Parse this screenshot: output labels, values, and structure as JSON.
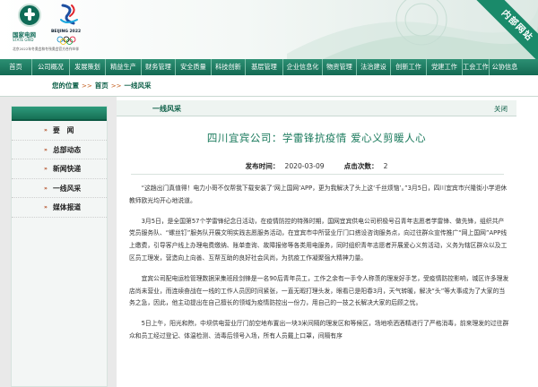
{
  "header": {
    "logo_cn": "国家电网",
    "logo_en": "STATE GRID",
    "olympic_text": "BEIJING 2022",
    "sponsor_text": "北京2022年冬奥会和冬残奥会官方合作伙伴",
    "corner_label": "内部网站",
    "colors": {
      "brand_green": "#0f6b57",
      "nav_green": "#1f7d62"
    }
  },
  "nav": {
    "items": [
      "首页",
      "公司概况",
      "发展策划",
      "精益生产",
      "财务管理",
      "安全质量",
      "科技创新",
      "基层管理",
      "企业信息化",
      "物资管理",
      "法治建设",
      "创新工作",
      "党建工作",
      "工会工作",
      "公协信息"
    ]
  },
  "breadcrumb": {
    "current_label": "您的位置",
    "items": [
      "首页",
      "一线风采"
    ]
  },
  "sidebar": {
    "items": [
      {
        "label": "要　闻",
        "icon": "double-arrow-icon"
      },
      {
        "label": "总部动态",
        "icon": "double-arrow-icon"
      },
      {
        "label": "新闻快递",
        "icon": "double-arrow-icon"
      },
      {
        "label": "一线风采",
        "icon": "double-arrow-icon"
      },
      {
        "label": "媒体报道",
        "icon": "double-arrow-icon"
      }
    ]
  },
  "content": {
    "section_title": "一线风采",
    "close_label": "关闭",
    "article_title": "四川宜宾公司：学雷锋抗疫情 爱心义剪暖人心",
    "meta": {
      "date_label": "发布时间：",
      "date_value": "2020-03-09",
      "clicks_label": "点击次数：",
      "clicks_value": "2"
    },
    "paragraphs": [
      "“这趟出门真值得！电力小哥不仅帮我下载安装了‘网上国网’APP，更为我解决了头上这‘千丝烦恼’。”3月5日，四川宜宾市兴隆街小学退休教师欧光均开心地说道。",
      "3月5日，是全国第57个学雷锋纪念日活动，在疫情防控的特殊时期，国网宜宾供电公司积极号召青年志愿者学雷锋、做先锋，组织共产党员服务队、“螺丝钉”服务队开展文明实践志愿服务活动，在宜宾市中所营业厅门口搭设咨询服务点，向过往群众宣传推广“网上国网”APP线上缴费，引导客户线上办理电费缴纳、账单查询、故障报修等各类用电服务，同时组织青年志愿者开展爱心义剪活动，义务为辖区群众以及工区员工理发，营造向上向善、互帮互助的良好社会风尚，为抗疫工作凝聚强大精神力量。",
      "宜宾公司配电运检管理数据采集班段剑锋是一名90后青年员工，工作之余有一手令人称羡的理发好手艺，受疫情防控影响，城区许多理发店尚未营业，而连续奋战在一线的工作人员因时间紧张，一直无暇打理头发，眼看已是阳春3月，天气转暖，解决“头”等大事成为了大家的当务之急，因此，他主动提出在自己擅长的领域为疫情防控出一份力，用自己的一技之长解决大家的后顾之忧。",
      "5日上午，阳光和煦，中坝供电营业厅门前空地布置出一块3米间隔的理发区和等候区，场地喷洒酒精进行了严格消毒，前来理发的过往群众和员工经过登记、体温检测、消毒后领号入场，所有人员戴上口罩，间隔有序"
    ]
  }
}
